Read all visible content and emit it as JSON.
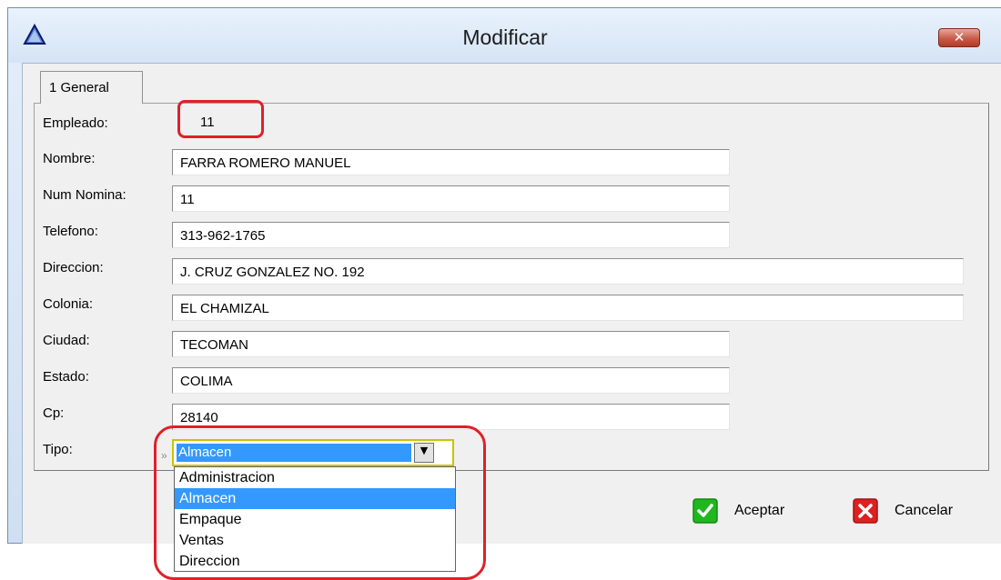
{
  "window": {
    "title": "Modificar"
  },
  "tab": {
    "label": "1 General"
  },
  "form": {
    "empleado_label": "Empleado:",
    "empleado_value": "11",
    "fields": [
      {
        "label": "Nombre:",
        "value": "FARRA ROMERO MANUEL"
      },
      {
        "label": "Num Nomina:",
        "value": "11"
      },
      {
        "label": "Telefono:",
        "value": "313-962-1765"
      },
      {
        "label": "Direccion:",
        "value": "J. CRUZ GONZALEZ NO. 192"
      },
      {
        "label": "Colonia:",
        "value": "EL CHAMIZAL"
      },
      {
        "label": "Ciudad:",
        "value": "TECOMAN"
      },
      {
        "label": "Estado:",
        "value": "COLIMA"
      },
      {
        "label": "Cp:",
        "value": "28140"
      }
    ],
    "tipo_label": "Tipo:",
    "tipo_selected": "Almacen",
    "tipo_options": [
      "Administracion",
      "Almacen",
      "Empaque",
      "Ventas",
      "Direccion"
    ]
  },
  "buttons": {
    "accept_label": "Aceptar",
    "cancel_label": "Cancelar"
  },
  "colors": {
    "highlight_red": "#e0202a",
    "selection_blue": "#3399ff",
    "accept_green": "#1fb81f",
    "cancel_red": "#e01f1f"
  }
}
